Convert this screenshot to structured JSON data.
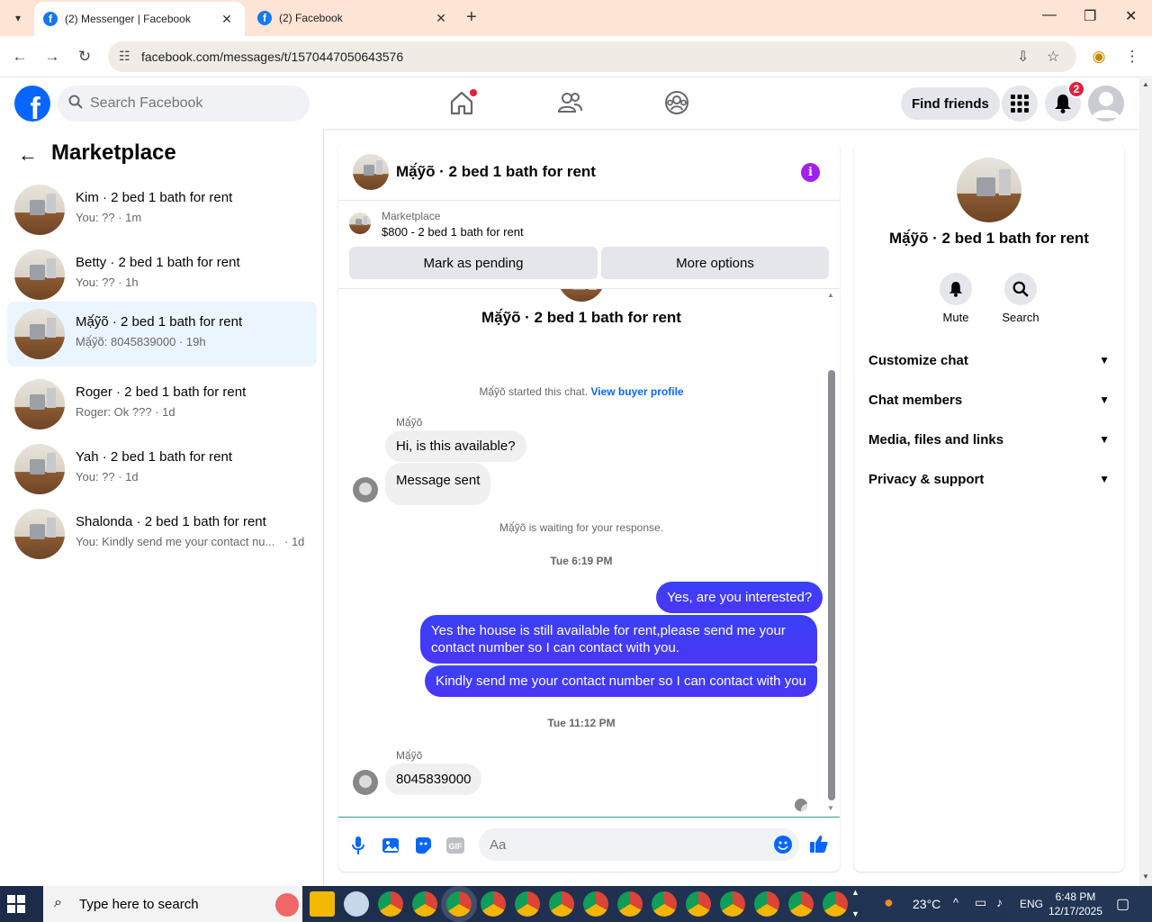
{
  "browser": {
    "tabs": [
      {
        "title": "(2) Messenger | Facebook"
      },
      {
        "title": "(2) Facebook"
      }
    ],
    "url": "facebook.com/messages/t/1570447050643576"
  },
  "header": {
    "search_placeholder": "Search Facebook",
    "find_friends": "Find friends",
    "notifications_count": "2"
  },
  "sidebar": {
    "title": "Marketplace",
    "conversations": [
      {
        "name": "Kim · 2 bed 1 bath for rent",
        "preview": "You: ?? · 1m"
      },
      {
        "name": "Betty · 2 bed 1 bath for rent",
        "preview": "You: ?? · 1h"
      },
      {
        "name": "Mặ́ỹõ · 2 bed 1 bath for rent",
        "preview": "Mặ́ỹõ: 8045839000 · 19h"
      },
      {
        "name": "Roger · 2 bed 1 bath for rent",
        "preview": "Roger: Ok ??? · 1d"
      },
      {
        "name": "Yah · 2 bed 1 bath for rent",
        "preview": "You: ?? · 1d"
      },
      {
        "name": "Shalonda · 2 bed 1 bath for rent",
        "preview": "You: Kindly send me your contact nu...",
        "time": "· 1d"
      }
    ]
  },
  "chat": {
    "title": "Mặ́ỹõ · 2 bed 1 bath for rent",
    "marketplace_label": "Marketplace",
    "listing": "$800 - 2 bed 1 bath for rent",
    "mark_pending": "Mark as pending",
    "more_options": "More options",
    "intro_title": "Mặ́ỹõ · 2 bed 1 bath for rent",
    "started_text": "Mặ́ỹõ started this chat.",
    "view_buyer": "View buyer profile",
    "sender_name": "Mặ́ỹõ",
    "msg1": "Hi, is this available?",
    "msg2": "Message sent",
    "waiting": "Mặ́ỹõ is waiting for your response.",
    "time1": "Tue 6:19 PM",
    "out1": "Yes, are you interested?",
    "out2": "Yes the house is still available for rent,please send me your contact number so I can contact with you.",
    "out3": "Kindly send me your contact number so I can contact with you",
    "time2": "Tue 11:12 PM",
    "msg3": "8045839000",
    "composer_placeholder": "Aa"
  },
  "details": {
    "name": "Mặ́ỹõ · 2 bed 1 bath for rent",
    "mute": "Mute",
    "search": "Search",
    "rows": [
      "Customize chat",
      "Chat members",
      "Media, files and links",
      "Privacy & support"
    ]
  },
  "taskbar": {
    "search_text": "Type here to search",
    "temperature": "23°C",
    "language": "ENG",
    "time": "6:48 PM",
    "date": "12/17/2025"
  }
}
